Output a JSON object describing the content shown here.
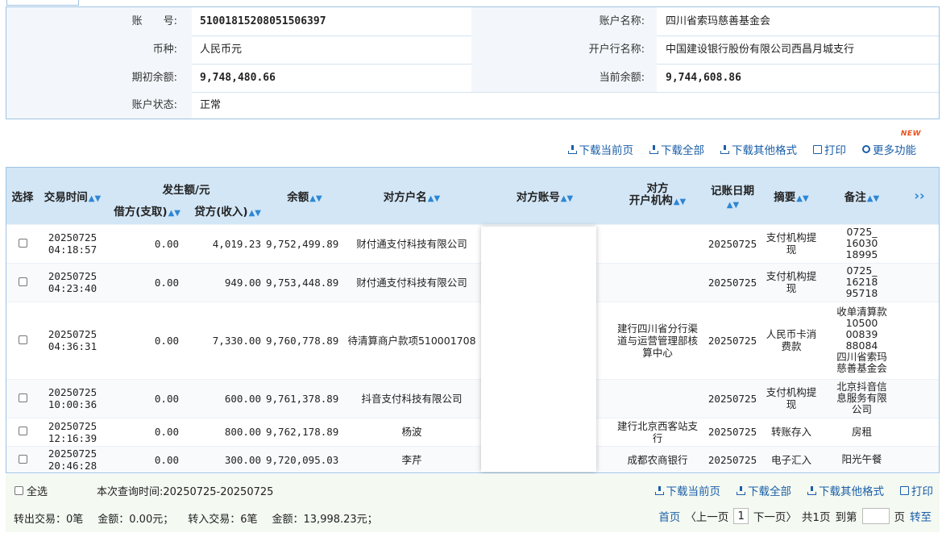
{
  "account": {
    "no_label": "账　　号:",
    "no_value": "51001815208051506397",
    "name_label": "账户名称:",
    "name_value": "四川省索玛慈善基金会",
    "currency_label": "币种:",
    "currency_value": "人民币元",
    "bank_label": "开户行名称:",
    "bank_value": "中国建设银行股份有限公司西昌月城支行",
    "open_label": "期初余额:",
    "open_value": "9,748,480.66",
    "cur_label": "当前余额:",
    "cur_value": "9,744,608.86",
    "status_label": "账户状态:",
    "status_value": "正常"
  },
  "toolbar": {
    "dl_page": "下载当前页",
    "dl_all": "下载全部",
    "dl_other": "下载其他格式",
    "print": "打印",
    "more": "更多功能",
    "new_badge": "NEW"
  },
  "table": {
    "headers": {
      "select": "选择",
      "time": "交易时间",
      "amount_group": "发生额/元",
      "debit": "借方(支取)",
      "credit": "贷方(收入)",
      "balance": "余额",
      "cp_name": "对方户名",
      "cp_account": "对方账号",
      "cp_bank_1": "对方",
      "cp_bank_2": "开户机构",
      "date": "记账日期",
      "summary": "摘要",
      "remark": "备注",
      "more": "››"
    },
    "rows": [
      {
        "time1": "20250725",
        "time2": "04:18:57",
        "debit": "0.00",
        "credit": "4,019.23",
        "balance": "9,752,499.89",
        "cp_name": "财付通支付科技有限公司",
        "cp_bank": "",
        "date": "20250725",
        "summary": "支付机构提现",
        "remark": "0725_\n16030\n18995"
      },
      {
        "time1": "20250725",
        "time2": "04:23:40",
        "debit": "0.00",
        "credit": "949.00",
        "balance": "9,753,448.89",
        "cp_name": "财付通支付科技有限公司",
        "cp_bank": "",
        "date": "20250725",
        "summary": "支付机构提现",
        "remark": "0725_\n16218\n95718"
      },
      {
        "time1": "20250725",
        "time2": "04:36:31",
        "debit": "0.00",
        "credit": "7,330.00",
        "balance": "9,760,778.89",
        "cp_name": "待清算商户款项510001708",
        "cp_bank": "建行四川省分行渠道与运营管理部核算中心",
        "date": "20250725",
        "summary": "人民币卡消费款",
        "remark": "收单清算款\n10500\n00839\n88084\n四川省索玛\n慈善基金会"
      },
      {
        "time1": "20250725",
        "time2": "10:00:36",
        "debit": "0.00",
        "credit": "600.00",
        "balance": "9,761,378.89",
        "cp_name": "抖音支付科技有限公司",
        "cp_bank": "",
        "date": "20250725",
        "summary": "支付机构提现",
        "remark": "北京抖音信\n息服务有限\n公司"
      },
      {
        "time1": "20250725",
        "time2": "12:16:39",
        "debit": "0.00",
        "credit": "800.00",
        "balance": "9,762,178.89",
        "cp_name": "杨波",
        "cp_bank": "建行北京西客站支行",
        "date": "20250725",
        "summary": "转账存入",
        "remark": "房租"
      },
      {
        "time1": "20250725",
        "time2": "20:46:28",
        "debit": "0.00",
        "credit": "300.00",
        "balance": "9,720,095.03",
        "cp_name": "李芹",
        "cp_bank": "成都农商银行",
        "date": "20250725",
        "summary": "电子汇入",
        "remark": "阳光午餐"
      }
    ]
  },
  "footer": {
    "select_all": "全选",
    "query_time": "本次查询时间:20250725-20250725",
    "dl_page": "下载当前页",
    "dl_all": "下载全部",
    "dl_other": "下载其他格式",
    "print": "打印",
    "out_tx": "转出交易：0笔",
    "out_amt": "金额：0.00元；",
    "in_tx": "转入交易：6笔",
    "in_amt": "金额：13,998.23元；",
    "first": "首页",
    "prev": "〈上一页",
    "page_cur": "1",
    "next": "下一页〉",
    "total": "共1页",
    "goto": "到第",
    "page_unit": "页",
    "go": "转至"
  }
}
